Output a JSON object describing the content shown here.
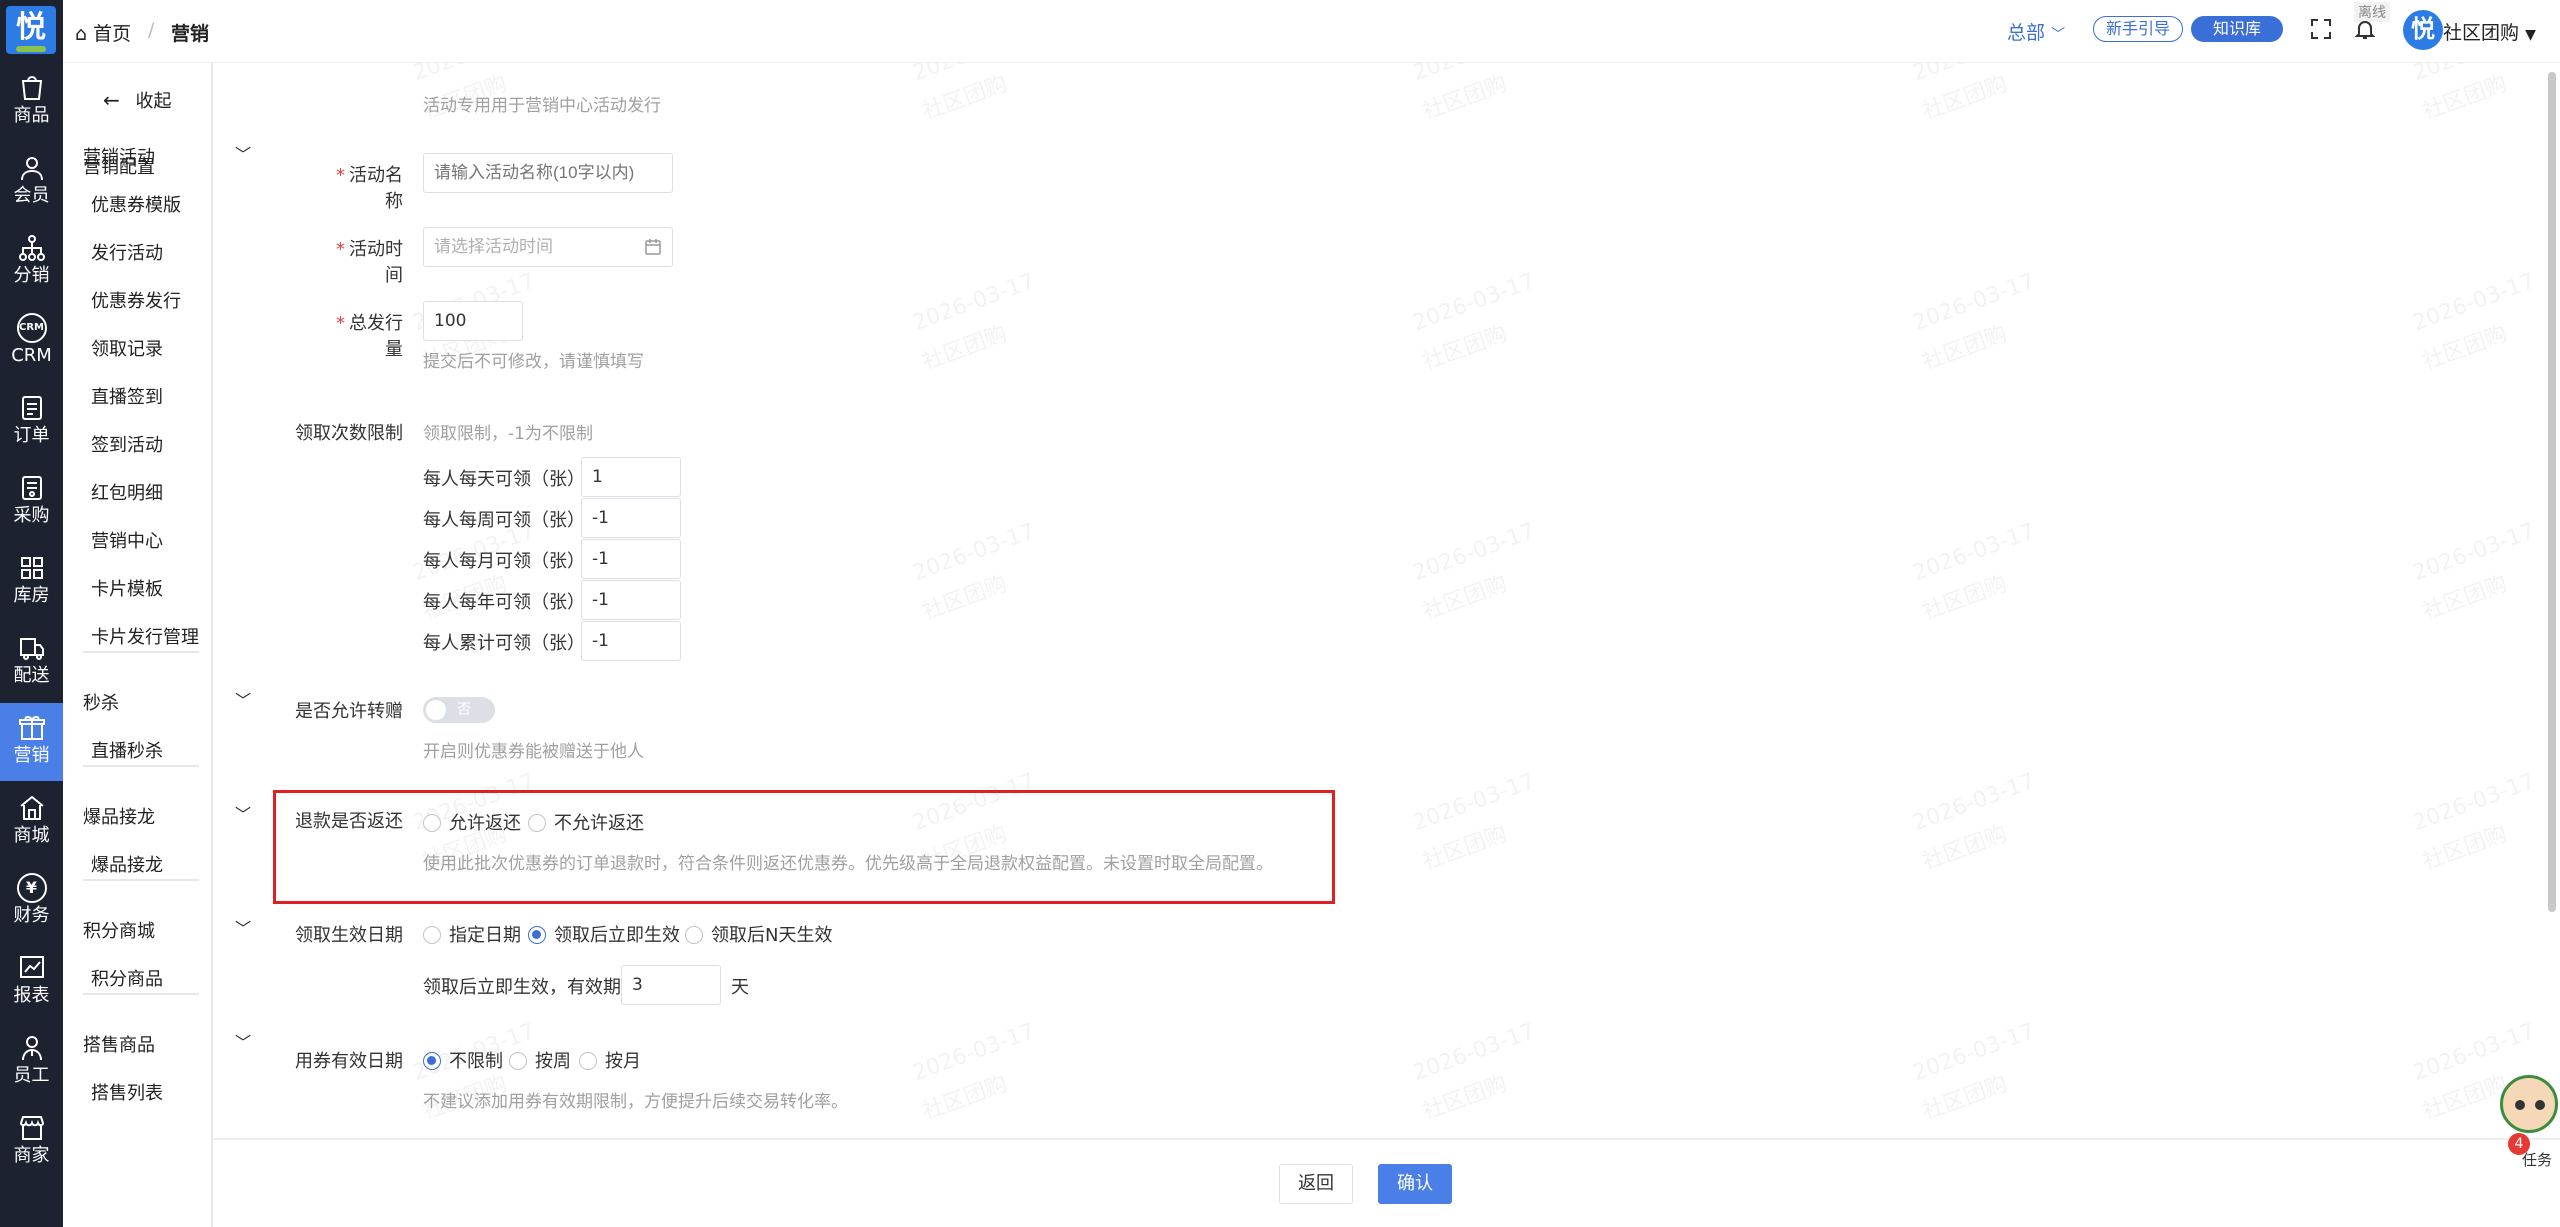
{
  "rail": {
    "logo": "悦",
    "items": [
      {
        "label": "商品",
        "icon": "bag-icon"
      },
      {
        "label": "会员",
        "icon": "user-icon"
      },
      {
        "label": "分销",
        "icon": "hierarchy-icon"
      },
      {
        "label": "CRM",
        "icon": "crm-icon",
        "icon_text": "CRM"
      },
      {
        "label": "订单",
        "icon": "order-icon"
      },
      {
        "label": "采购",
        "icon": "purchase-icon"
      },
      {
        "label": "库房",
        "icon": "warehouse-icon"
      },
      {
        "label": "配送",
        "icon": "delivery-icon"
      },
      {
        "label": "营销",
        "icon": "gift-icon"
      },
      {
        "label": "商城",
        "icon": "shop-icon"
      },
      {
        "label": "财务",
        "icon": "yuan-icon",
        "icon_text": "¥"
      },
      {
        "label": "报表",
        "icon": "chart-icon"
      },
      {
        "label": "员工",
        "icon": "staff-icon"
      },
      {
        "label": "商家",
        "icon": "store-icon"
      }
    ],
    "active_index": 8
  },
  "submenu": {
    "collapse": "收起",
    "config": "营销配置",
    "groups": [
      {
        "title": "营销活动",
        "items": [
          "优惠券模版",
          "发行活动",
          "优惠券发行",
          "领取记录",
          "直播签到",
          "签到活动",
          "红包明细",
          "营销中心",
          "卡片模板",
          "卡片发行管理"
        ]
      },
      {
        "title": "秒杀",
        "items": [
          "直播秒杀"
        ]
      },
      {
        "title": "爆品接龙",
        "items": [
          "爆品接龙"
        ]
      },
      {
        "title": "积分商城",
        "items": [
          "积分商品"
        ]
      },
      {
        "title": "搭售商品",
        "items": [
          "搭售列表"
        ]
      }
    ]
  },
  "topbar": {
    "home": "首页",
    "separator": "/",
    "current": "营销",
    "region": "总部",
    "guide": "新手引导",
    "knowledge": "知识库",
    "offline": "离线",
    "avatar": "悦",
    "user": "社区团购"
  },
  "form": {
    "top_hint": "活动专用用于营销中心活动发行",
    "name": {
      "required": "*",
      "label": "活动名称",
      "placeholder": "请输入活动名称(10字以内)"
    },
    "time": {
      "required": "*",
      "label": "活动时间",
      "placeholder": "请选择活动时间"
    },
    "total": {
      "required": "*",
      "label": "总发行量",
      "value": "100",
      "hint": "提交后不可修改，请谨慎填写"
    },
    "limit": {
      "label": "领取次数限制",
      "hint": "领取限制，-1为不限制",
      "rows": [
        {
          "label": "每人每天可领（张）",
          "value": "1"
        },
        {
          "label": "每人每周可领（张）",
          "value": "-1"
        },
        {
          "label": "每人每月可领（张）",
          "value": "-1"
        },
        {
          "label": "每人每年可领（张）",
          "value": "-1"
        },
        {
          "label": "每人累计可领（张）",
          "value": "-1"
        }
      ]
    },
    "transfer": {
      "label": "是否允许转赠",
      "switch_text": "否",
      "on": false,
      "hint": "开启则优惠券能被赠送于他人"
    },
    "refund": {
      "label": "退款是否返还",
      "options": [
        "允许返还",
        "不允许返还"
      ],
      "selected": -1,
      "hint": "使用此批次优惠券的订单退款时，符合条件则返还优惠券。优先级高于全局退款权益配置。未设置时取全局配置。"
    },
    "effective": {
      "label": "领取生效日期",
      "options": [
        "指定日期",
        "领取后立即生效",
        "领取后N天生效"
      ],
      "selected": 1,
      "validity_prefix": "领取后立即生效，有效期",
      "validity_value": "3",
      "validity_unit": "天"
    },
    "usage": {
      "label": "用券有效日期",
      "options": [
        "不限制",
        "按周",
        "按月"
      ],
      "selected": 0,
      "hint": "不建议添加用券有效期限制，方便提升后续交易转化率。"
    }
  },
  "footer": {
    "back": "返回",
    "confirm": "确认"
  },
  "watermark": {
    "date": "2026-03-17",
    "text": "社区团购"
  },
  "task": {
    "badge": "4",
    "label": "任务"
  },
  "colors": {
    "accent": "#3a6fd8",
    "rail_bg": "#1c2230",
    "required": "#e04040",
    "highlight": "#e02020"
  }
}
